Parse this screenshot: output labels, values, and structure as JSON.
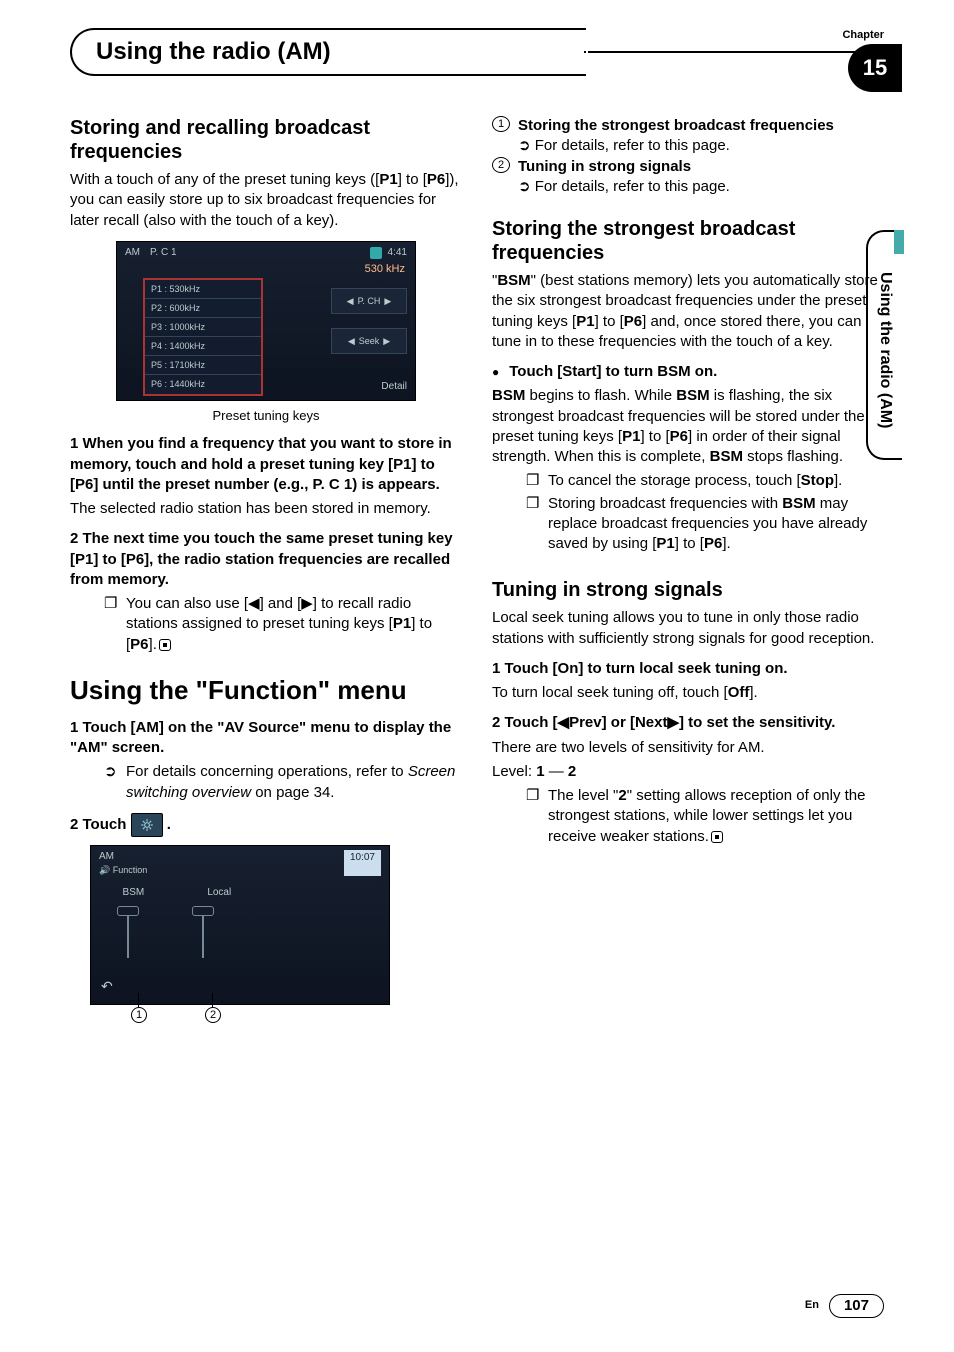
{
  "chapter": {
    "label": "Chapter",
    "number": "15"
  },
  "header": {
    "title": "Using the radio (AM)"
  },
  "side_tab": "Using the radio (AM)",
  "left": {
    "sect1_title": "Storing and recalling broadcast frequencies",
    "sect1_intro_a": "With a touch of any of the preset tuning keys ([",
    "p1": "P1",
    "to": "] to [",
    "p6": "P6",
    "sect1_intro_b": "]), you can easily store up to six broadcast frequencies for later recall (also with the touch of a key).",
    "shot1": {
      "band": "AM",
      "pc": "P. C 1",
      "time": "4:41",
      "freq": "530 kHz",
      "presets": [
        "P1 : 530kHz",
        "P2 : 600kHz",
        "P3 : 1000kHz",
        "P4 : 1400kHz",
        "P5 : 1710kHz",
        "P6 : 1440kHz"
      ],
      "pch": "P. CH",
      "seek": "Seek",
      "detail": "Detail"
    },
    "caption1": "Preset tuning keys",
    "step1_lead": "1   When you find a frequency that you want to store in memory, touch and hold a preset tuning key [P1] to [P6] until the preset number (e.g., P. C 1) is appears.",
    "step1_body": "The selected radio station has been stored in memory.",
    "step2_lead": "2   The next time you touch the same preset tuning key [P1] to [P6], the radio station frequencies are recalled from memory.",
    "step2_note_a": "You can also use [◀] and [▶] to recall radio stations assigned to preset tuning keys [",
    "step2_note_b": "] to [",
    "step2_note_c": "].",
    "funcmenu_title": "Using the \"Function\" menu",
    "func_step1": "1   Touch [AM] on the \"AV Source\" menu to display the \"AM\" screen.",
    "func_step1_note_a": "For details concerning operations, refer to ",
    "func_step1_note_i": "Screen switching overview",
    "func_step1_note_b": " on page 34.",
    "func_step2_a": "2   Touch ",
    "func_step2_b": " .",
    "shot2": {
      "band": "AM",
      "sub": "Function",
      "time": "10:07",
      "bsm": "BSM",
      "local": "Local"
    },
    "call1": "1",
    "call2": "2"
  },
  "right": {
    "n1_title": "Storing the strongest broadcast frequencies",
    "n1_sub": "For details, refer to this page.",
    "n2_title": "Tuning in strong signals",
    "n2_sub": "For details, refer to this page.",
    "sect2_title": "Storing the strongest broadcast frequencies",
    "sect2_p_a": "\"",
    "bsm": "BSM",
    "sect2_p_b": "\" (best stations memory) lets you automatically store the six strongest broadcast frequencies under the preset tuning keys [",
    "p1": "P1",
    "to": "] to [",
    "p6": "P6",
    "sect2_p_c": "] and, once stored there, you can tune in to these frequencies with the touch of a key.",
    "bsm_on": "Touch [Start] to turn BSM on.",
    "bsm_body_a": " begins to flash. While ",
    "bsm_body_b": " is flashing, the six strongest broadcast frequencies will be stored under the preset tuning keys [",
    "bsm_body_c": "] in order of their signal strength. When this is complete, ",
    "bsm_body_d": " stops flashing.",
    "stop_a": "To cancel the storage process, touch [",
    "stop_b": "Stop",
    "stop_c": "].",
    "replace_a": "Storing broadcast frequencies with ",
    "replace_b": " may replace broadcast frequencies you have already saved by using [",
    "replace_c": "].",
    "sect3_title": "Tuning in strong signals",
    "sect3_intro": "Local seek tuning allows you to tune in only those radio stations with sufficiently strong signals for good reception.",
    "s3_step1": "1   Touch [On] to turn local seek tuning on.",
    "s3_step1_body_a": "To turn local seek tuning off, touch [",
    "off": "Off",
    "s3_step1_body_b": "].",
    "s3_step2": "2   Touch [◀Prev] or [Next▶] to set the sensitivity.",
    "s3_step2_body": "There are two levels of sensitivity for AM.",
    "level_a": "Level: ",
    "l1": "1",
    "dash": " — ",
    "l2": "2",
    "s3_note_a": "The level \"",
    "s3_note_b": "\" setting allows reception of only the strongest stations, while lower settings let you receive weaker stations."
  },
  "footer": {
    "lang": "En",
    "page": "107"
  }
}
